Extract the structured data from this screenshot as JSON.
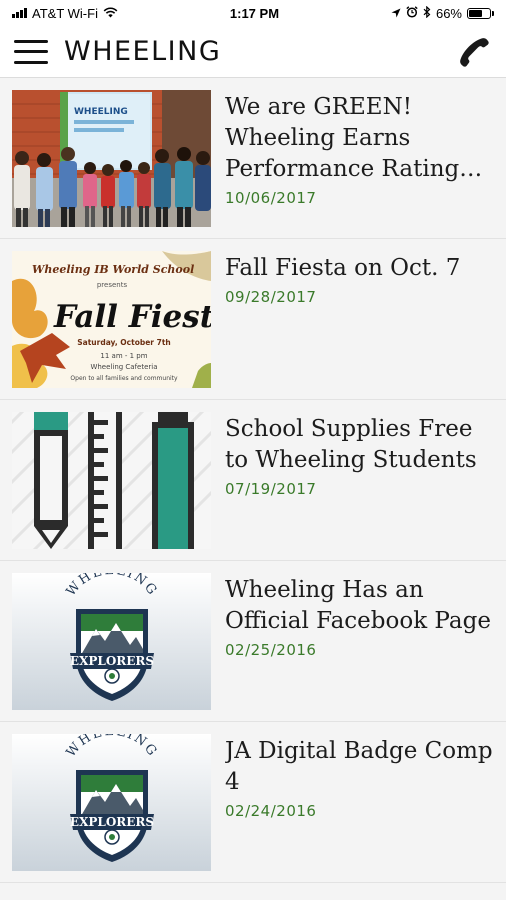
{
  "status_bar": {
    "carrier": "AT&T Wi-Fi",
    "time": "1:17 PM",
    "battery": "66%",
    "battery_level": 0.66
  },
  "header": {
    "title": "WHEELING",
    "menu_icon": "hamburger-menu-icon",
    "phone_icon": "phone-icon"
  },
  "news": [
    {
      "title": "We are GREEN! Wheeling Earns Performance Rating f...",
      "date": "10/06/2017",
      "thumb": "group-photo",
      "banner_text": "WHEELING"
    },
    {
      "title": "Fall Fiesta on Oct. 7",
      "date": "09/28/2017",
      "thumb": "fall-fiesta-flyer",
      "flyer": {
        "school": "Wheeling IB World School",
        "presents": "presents",
        "event": "Fall Fiesta",
        "day": "Saturday, October 7th",
        "time": "11 am - 1 pm",
        "place": "Wheeling Cafeteria",
        "note": "Open to all families and community"
      }
    },
    {
      "title": "School Supplies Free to Wheeling Students",
      "date": "07/19/2017",
      "thumb": "school-supplies-icon"
    },
    {
      "title": "Wheeling Has an Official Facebook Page",
      "date": "02/25/2016",
      "thumb": "wheeling-explorers-logo",
      "logo": {
        "arc": "WHEELING",
        "banner": "EXPLORERS"
      }
    },
    {
      "title": "JA Digital Badge Comp 4",
      "date": "02/24/2016",
      "thumb": "wheeling-explorers-logo",
      "logo": {
        "arc": "WHEELING",
        "banner": "EXPLORERS"
      }
    }
  ],
  "colors": {
    "date_green": "#3a7a2a",
    "teal": "#2a9a84",
    "logo_green": "#2f7d3a",
    "logo_navy": "#1e3552"
  }
}
